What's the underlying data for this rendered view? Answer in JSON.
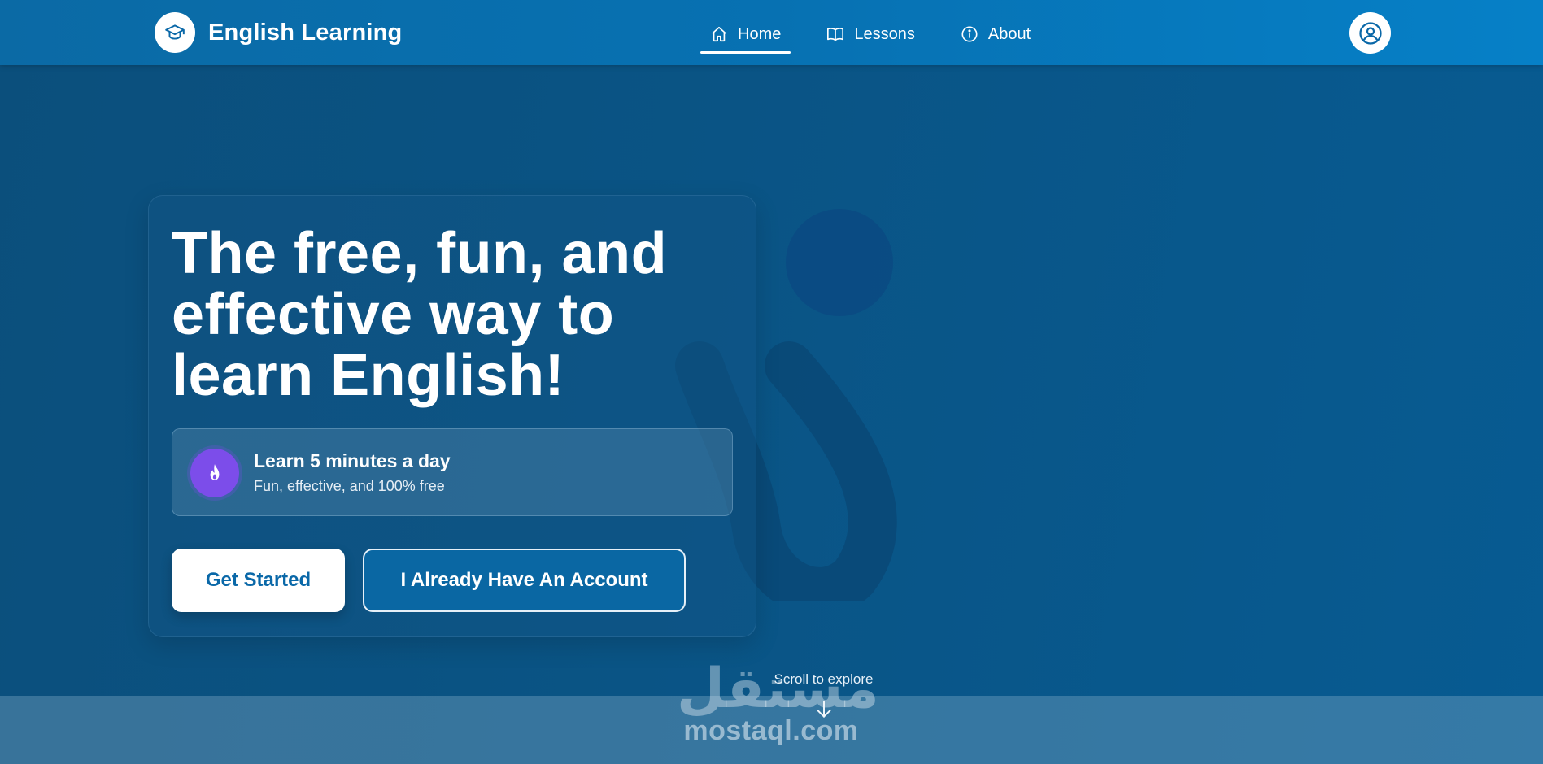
{
  "header": {
    "brand_name": "English Learning",
    "brand_icon": "graduation-cap-icon",
    "nav": [
      {
        "label": "Home",
        "icon": "home-icon",
        "active": true
      },
      {
        "label": "Lessons",
        "icon": "book-icon",
        "active": false
      },
      {
        "label": "About",
        "icon": "info-icon",
        "active": false
      }
    ],
    "profile_icon": "user-circle-icon"
  },
  "hero": {
    "title": "The free, fun, and effective way to learn English!",
    "feature": {
      "icon": "flame-icon",
      "title": "Learn 5 minutes a day",
      "subtitle": "Fun, effective, and 100% free"
    },
    "primary_button": "Get Started",
    "secondary_button": "I Already Have An Account"
  },
  "scroll_hint": "Scroll to explore",
  "watermark": {
    "arabic": "مستقل",
    "latin": "mostaql.com"
  },
  "colors": {
    "accent": "#0a68a8",
    "feature_icon_bg": "#7c4dea",
    "navbar": "#0771b2"
  }
}
